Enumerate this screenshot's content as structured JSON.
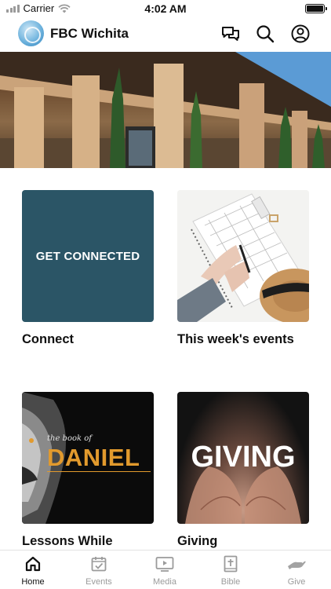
{
  "status_bar": {
    "carrier": "Carrier",
    "time": "4:02 AM"
  },
  "header": {
    "title": "FBC Wichita",
    "icons": [
      "messages-icon",
      "search-icon",
      "account-icon"
    ]
  },
  "cards": [
    {
      "label": "Connect",
      "image_text": "GET CONNECTED",
      "image_color": "#2b5566"
    },
    {
      "label": "This week's events"
    },
    {
      "label": "Lessons While Living in Dark",
      "image_small_text": "the book of",
      "image_big_text": "DANIEL",
      "accent_color": "#e29a2d"
    },
    {
      "label": "Giving",
      "image_text": "GIVING"
    }
  ],
  "bottom_nav": [
    {
      "label": "Home",
      "icon": "home-icon",
      "active": true
    },
    {
      "label": "Events",
      "icon": "calendar-check-icon",
      "active": false
    },
    {
      "label": "Media",
      "icon": "play-icon",
      "active": false
    },
    {
      "label": "Bible",
      "icon": "bible-icon",
      "active": false
    },
    {
      "label": "Give",
      "icon": "give-hand-icon",
      "active": false
    }
  ]
}
